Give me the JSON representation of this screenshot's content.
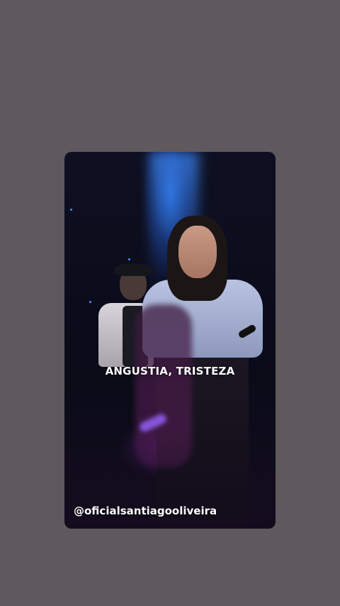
{
  "story": {
    "caption": "ANGUSTIA, TRISTEZA",
    "handle": "@oficialsantiagooliveira"
  },
  "colors": {
    "page_background": "#5f595d",
    "caption_text": "#ffffff",
    "stage_light": "#2878e6"
  }
}
